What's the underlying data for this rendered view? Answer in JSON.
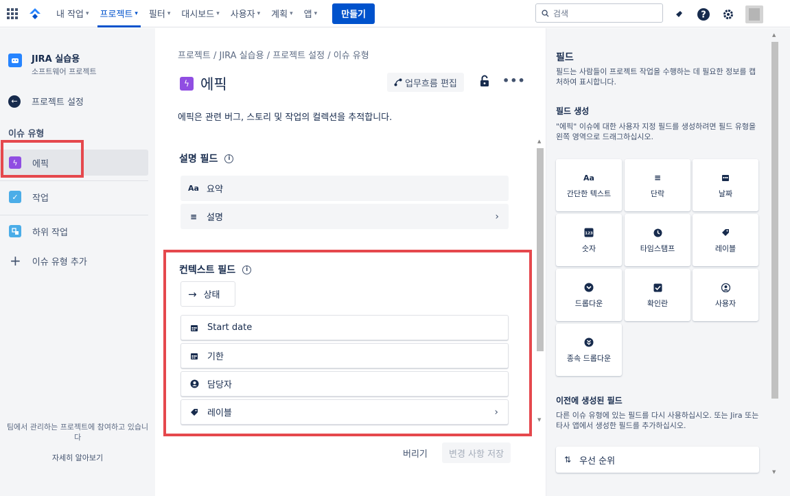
{
  "topnav": {
    "items": [
      {
        "label": "내 작업"
      },
      {
        "label": "프로젝트"
      },
      {
        "label": "필터"
      },
      {
        "label": "대시보드"
      },
      {
        "label": "사용자"
      },
      {
        "label": "계획"
      },
      {
        "label": "앱"
      }
    ],
    "active_item": "프로젝트",
    "create_label": "만들기",
    "search_placeholder": "검색"
  },
  "sidebar": {
    "project_name": "JIRA 실습용",
    "project_type": "소프트웨어 프로젝트",
    "back_label": "프로젝트 설정",
    "section_heading": "이슈 유형",
    "items": [
      {
        "label": "에픽",
        "selected": true,
        "color": "#904ee2"
      },
      {
        "label": "작업",
        "selected": false,
        "color": "#4bade8"
      },
      {
        "label": "하위 작업",
        "selected": false,
        "color": "#4bade8"
      }
    ],
    "add_label": "이슈 유형 추가",
    "footer_text": "팀에서 관리하는 프로젝트에 참여하고 있습니다",
    "footer_link": "자세히 알아보기"
  },
  "main": {
    "breadcrumb": "프로젝트 / JIRA 실습용 / 프로젝트 설정 / 이슈 유형",
    "title": "에픽",
    "workflow_button": "업무흐름 편집",
    "description": "에픽은 관련 버그, 스토리 및 작업의 컬렉션을 추적합니다.",
    "description_fields_title": "설명 필드",
    "description_fields": [
      {
        "icon": "text-icon",
        "label": "요약"
      },
      {
        "icon": "paragraph-icon",
        "label": "설명"
      }
    ],
    "context_fields_title": "컨텍스트 필드",
    "status_label": "상태",
    "context_fields": [
      {
        "icon": "calendar-icon",
        "label": "Start date"
      },
      {
        "icon": "calendar-icon",
        "label": "기한"
      },
      {
        "icon": "user-icon",
        "label": "담당자"
      },
      {
        "icon": "tag-icon",
        "label": "레이블"
      }
    ],
    "discard_label": "버리기",
    "save_label": "변경 사항 저장"
  },
  "right_panel": {
    "title": "필드",
    "intro": "필드는 사람들이 프로젝트 작업을 수행하는 데 필요한 정보를 캡처하여 표시합니다.",
    "create_heading": "필드 생성",
    "create_text": "\"에픽\" 이슈에 대한 사용자 지정 필드를 생성하려면 필드 유형을 왼쪽 영역으로 드래그하십시오.",
    "tiles": [
      {
        "icon": "text-icon",
        "label": "간단한 텍스트"
      },
      {
        "icon": "paragraph-icon",
        "label": "단락"
      },
      {
        "icon": "calendar-icon",
        "label": "날짜"
      },
      {
        "icon": "number-icon",
        "label": "숫자"
      },
      {
        "icon": "clock-icon",
        "label": "타임스탬프"
      },
      {
        "icon": "tag-icon",
        "label": "레이블"
      },
      {
        "icon": "dropdown-icon",
        "label": "드롭다운"
      },
      {
        "icon": "checkbox-icon",
        "label": "확인란"
      },
      {
        "icon": "user-icon",
        "label": "사용자"
      },
      {
        "icon": "cascade-dropdown-icon",
        "label": "종속 드롭다운"
      }
    ],
    "previous_heading": "이전에 생성된 필드",
    "previous_text": "다른 이슈 유형에 있는 필드를 다시 사용하십시오. 또는 Jira 또는 타사 앱에서 생성한 필드를 추가하십시오.",
    "priority_label": "우선 순위"
  },
  "colors": {
    "accent": "#0052cc",
    "highlight": "#e5484d",
    "epic": "#904ee2"
  }
}
